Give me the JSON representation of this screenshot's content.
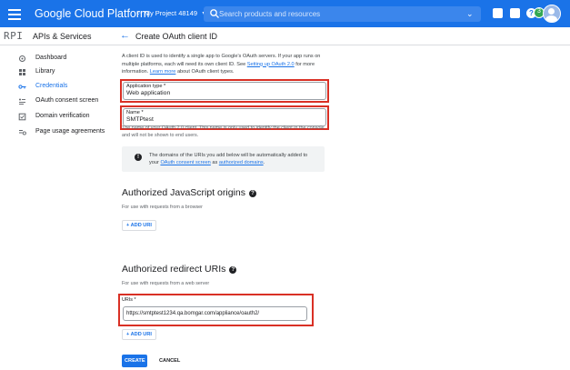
{
  "topbar": {
    "brand": "Google Cloud Platform",
    "project": "My Project 48149",
    "search_placeholder": "Search products and resources",
    "account_badge": "3",
    "help_glyph": "?",
    "more_glyph": "⋮",
    "icons": [
      "menu-icon",
      "project-dots-icon",
      "search-icon",
      "chevron-down-icon",
      "gift-icon",
      "terminal-icon",
      "help-icon",
      "notifications-icon",
      "more-vert-icon",
      "avatar"
    ]
  },
  "sidebar": {
    "logo": "RPI",
    "title": "APIs & Services",
    "items": [
      {
        "label": "Dashboard",
        "icon": "dashboard-icon",
        "active": false
      },
      {
        "label": "Library",
        "icon": "library-icon",
        "active": false
      },
      {
        "label": "Credentials",
        "icon": "key-icon",
        "active": true
      },
      {
        "label": "OAuth consent screen",
        "icon": "consent-icon",
        "active": false
      },
      {
        "label": "Domain verification",
        "icon": "checkbox-icon",
        "active": false
      },
      {
        "label": "Page usage agreements",
        "icon": "settings-list-icon",
        "active": false
      }
    ]
  },
  "header": {
    "back_glyph": "←",
    "title": "Create OAuth client ID"
  },
  "form": {
    "intro_1": "A client ID is used to identify a single app to Google's OAuth servers. If your app runs on multiple platforms, each will need its own client ID. See ",
    "intro_link_1": "Setting up OAuth 2.0",
    "intro_2": " for more information. ",
    "intro_link_2": "Learn more",
    "intro_3": " about OAuth client types.",
    "app_type_label": "Application type *",
    "app_type_value": "Web application",
    "name_label": "Name *",
    "name_value": "SMTPtest",
    "name_helper": "The name of your OAuth 2.0 client. This name is only used to identify the client in the console and will not be shown to end users.",
    "notice_icon": "!",
    "notice_1": "The domains of the URIs you add below will be automatically added to your ",
    "notice_link_1": "OAuth consent screen",
    "notice_2": " as ",
    "notice_link_2": "authorized domains",
    "notice_3": ".",
    "js_origins": {
      "title": "Authorized JavaScript origins",
      "help_glyph": "?",
      "subtitle": "For use with requests from a browser",
      "add_label": "+ ADD URI"
    },
    "redirect": {
      "title": "Authorized redirect URIs",
      "help_glyph": "?",
      "subtitle": "For use with requests from a web server",
      "uri_label": "URIs *",
      "uri_value": "https://smtptest1234.qa.bomgar.com/appliance/oauth2/",
      "add_label": "+ ADD URI"
    },
    "create_label": "CREATE",
    "cancel_label": "CANCEL"
  },
  "colors": {
    "brand_blue": "#1a73e8",
    "highlight_red": "#d93025",
    "text_dark": "#202124",
    "text_muted": "#5f6368"
  }
}
